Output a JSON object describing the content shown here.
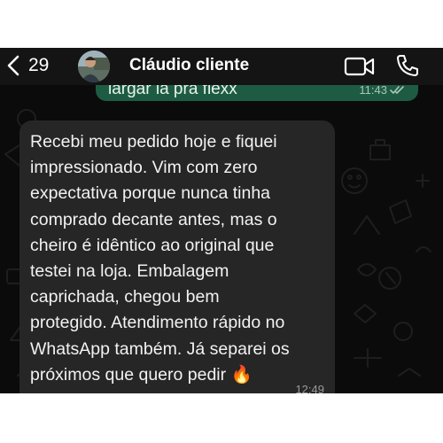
{
  "header": {
    "back_count": "29",
    "contact_name": "Cláudio cliente"
  },
  "messages": [
    {
      "direction": "outgoing",
      "text": "largar la pra flexx",
      "time": "11:43",
      "status": "read"
    },
    {
      "direction": "incoming",
      "text": "Recebi meu pedido hoje e fiquei\nimpressionado. Vim com zero\nexpectativa porque nunca tinha\ncomprado decante antes, mas o\ncheiro é idêntico ao original que\ntestei na loja. Embalagem\ncaprichada, chegou bem\nprotegido. Atendimento rápido no\nWhatsApp também. Já separei os\npróximos que quero pedir 🔥",
      "time": "12:49"
    }
  ],
  "colors": {
    "chat_background": "#0b0b0b",
    "header_background": "#141414",
    "outgoing_bubble": "#1d5c43",
    "incoming_bubble": "#262626",
    "read_ticks": "#a9c7b9"
  },
  "icons": {
    "back": "chevron-left-icon",
    "video": "video-camera-icon",
    "call": "phone-icon",
    "read_status": "double-check-icon"
  }
}
